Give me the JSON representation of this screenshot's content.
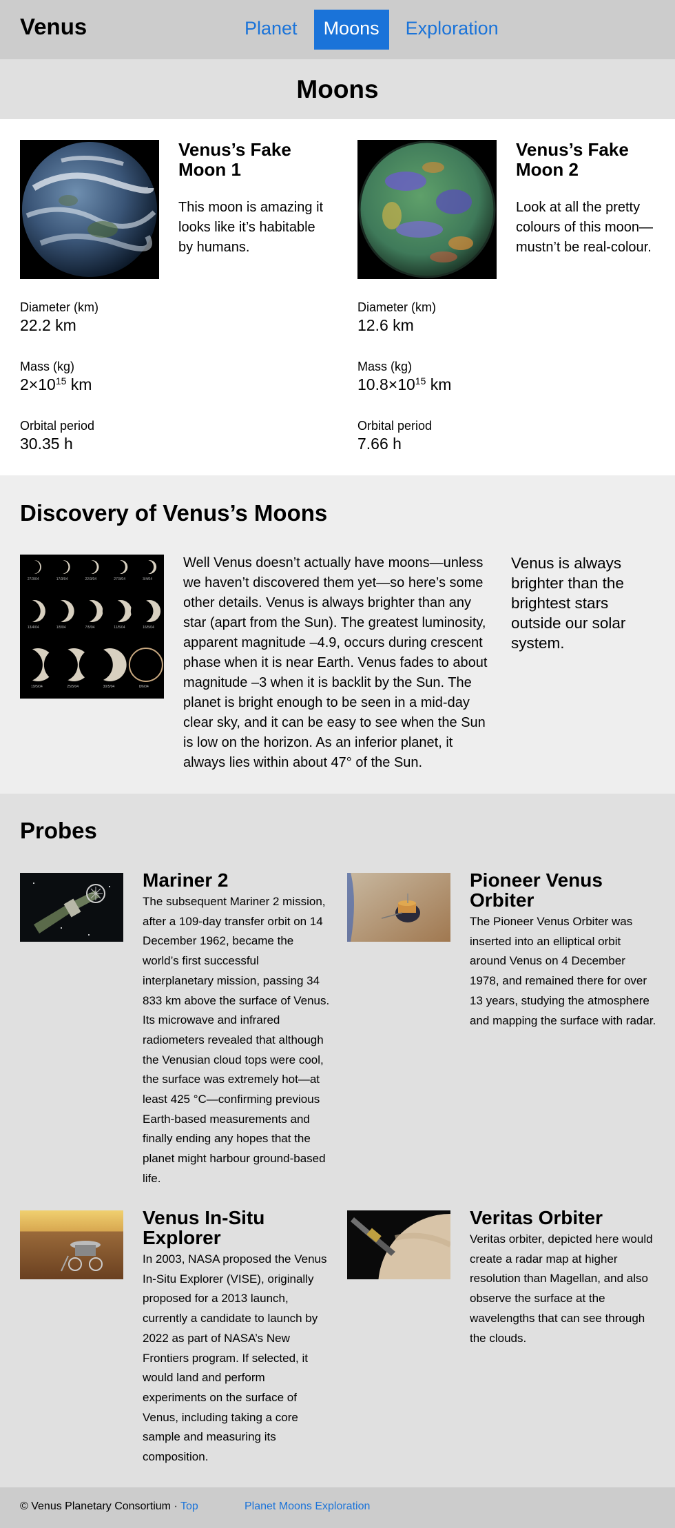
{
  "header": {
    "brand": "Venus",
    "nav": [
      "Planet",
      "Moons",
      "Exploration"
    ],
    "active": "Moons",
    "accent_color": "#1a73d9"
  },
  "page_title": "Moons",
  "moons": [
    {
      "name": "Venus’s Fake Moon 1",
      "description": "This moon is amazing it looks like it’s habitable by humans.",
      "diameter_label": "Diameter (km)",
      "diameter": "22.2 km",
      "mass_label": "Mass (kg)",
      "mass_base": "2×10",
      "mass_exp": "15",
      "mass_unit": " km",
      "orbital_label": "Orbital period",
      "orbital_period": "30.35 h",
      "image": "earth-like-moon-image"
    },
    {
      "name": "Venus’s Fake Moon 2",
      "description": "Look at all the pretty colours of this moon—mustn’t be real-colour.",
      "diameter_label": "Diameter (km)",
      "diameter": "12.6 km",
      "mass_label": "Mass (kg)",
      "mass_base": "10.8×10",
      "mass_exp": "15",
      "mass_unit": " km",
      "orbital_label": "Orbital period",
      "orbital_period": "7.66 h",
      "image": "false-colour-moon-image"
    }
  ],
  "discovery": {
    "heading": "Discovery of Venus’s Moons",
    "body": "Well Venus doesn’t actually have moons—unless we haven’t discovered them yet—so here’s some other details. Venus is always brighter than any star (apart from the Sun). The greatest luminosity, apparent magnitude –4.9, occurs during crescent phase when it is near Earth. Venus fades to about magnitude –3 when it is backlit by the Sun. The planet is bright enough to be seen in a mid-day clear sky, and it can be easy to see when the Sun is low on the horizon. As an inferior planet, it always lies within about 47° of the Sun.",
    "aside": "Venus is always brighter than the brightest stars outside our solar system.",
    "phase_labels": [
      "27/3/04",
      "17/3/04",
      "22/3/04",
      "27/3/04",
      "3/4/04",
      "13/4/04",
      "1/5/04",
      "7/5/04",
      "11/5/04",
      "16/5/04",
      "19/5/04",
      "25/5/04",
      "30/5/04",
      "8/6/04"
    ]
  },
  "probes": {
    "heading": "Probes",
    "items": [
      {
        "name": "Mariner 2",
        "text": "The subsequent Mariner 2 mission, after a 109-day transfer orbit on 14 December 1962, became the world’s first successful interplanetary mission, passing 34 833 km above the surface of Venus. Its microwave and infrared radiometers revealed that although the Venusian cloud tops were cool, the surface was extremely hot—at least 425 °C—confirming previous Earth-based measurements and finally ending any hopes that the planet might harbour ground-based life.",
        "image": "mariner-2-spacecraft-image"
      },
      {
        "name": "Pioneer Venus Orbiter",
        "text": "The Pioneer Venus Orbiter was inserted into an elliptical orbit around Venus on 4 December 1978, and remained there for over 13 years, studying the atmosphere and mapping the surface with radar.",
        "image": "pioneer-venus-orbiter-image"
      },
      {
        "name": "Venus In-Situ Explorer",
        "text": "In 2003, NASA proposed the Venus In-Situ Explorer (VISE), originally proposed for a 2013 launch, currently a candidate to launch by 2022 as part of NASA’s New Frontiers program. If selected, it would land and perform experiments on the surface of Venus, including taking a core sample and measuring its composition.",
        "image": "venus-lander-image"
      },
      {
        "name": "Veritas Orbiter",
        "text": "Veritas orbiter, depicted here would create a radar map at higher resolution than Magellan, and also observe the surface at the wavelengths that can see through the clouds.",
        "image": "veritas-orbiter-image"
      }
    ]
  },
  "footer": {
    "copyright": "© Venus Planetary Consortium · ",
    "top_link": "Top",
    "nav": [
      "Planet",
      "Moons",
      "Exploration"
    ]
  }
}
